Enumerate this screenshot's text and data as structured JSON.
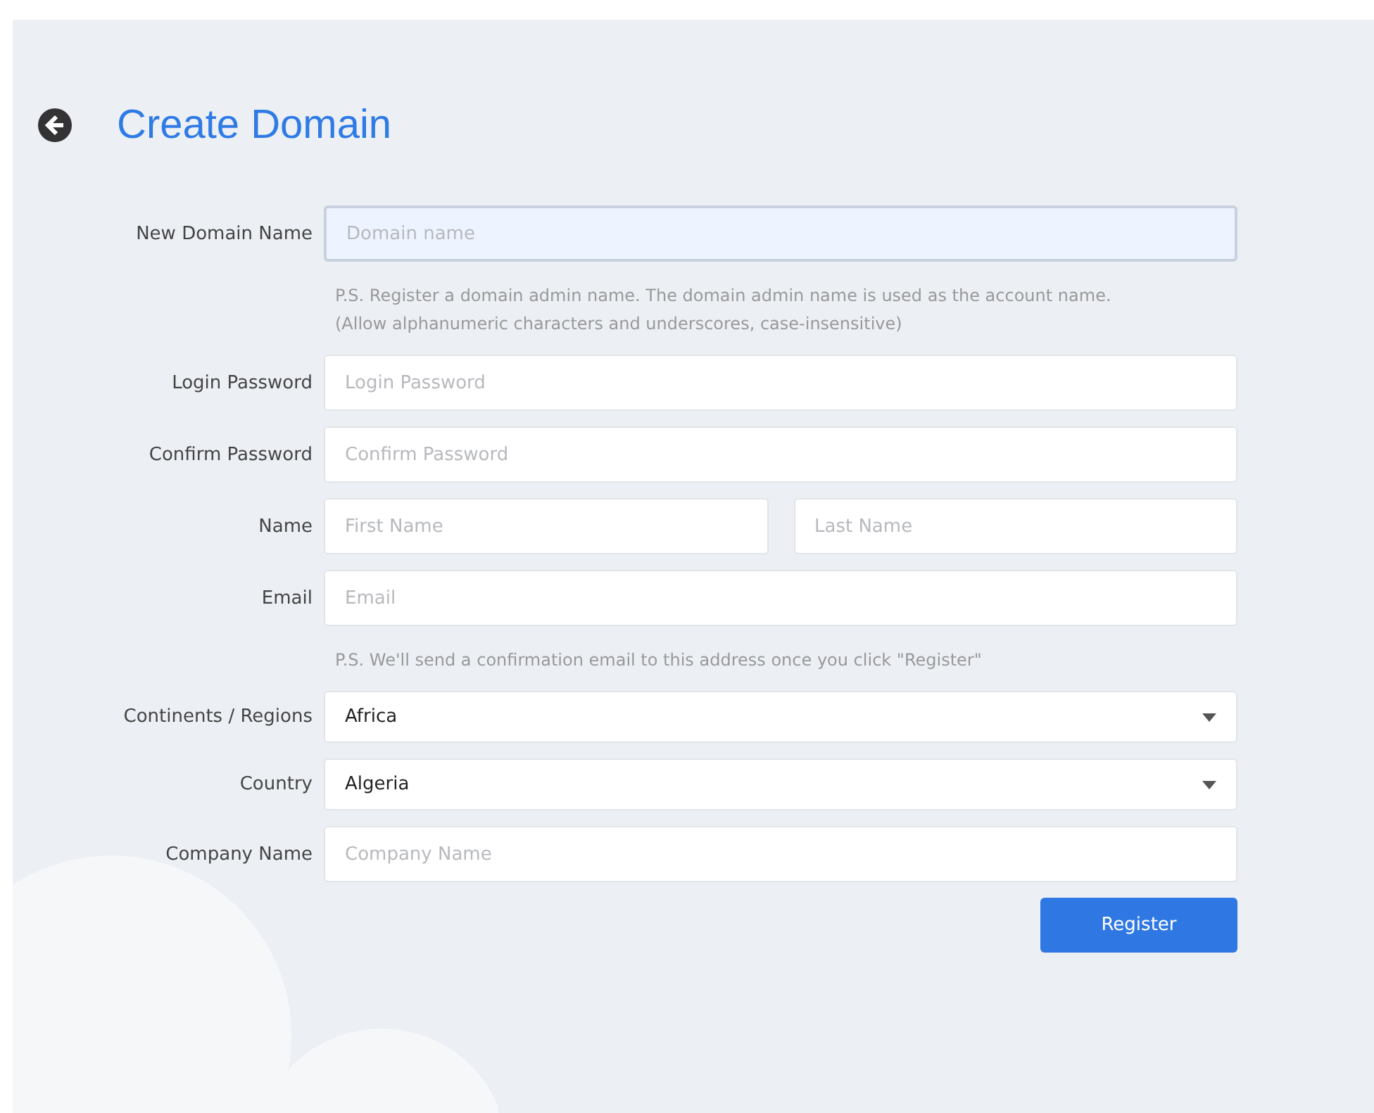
{
  "header": {
    "title": "Create Domain"
  },
  "form": {
    "rows": [
      {
        "kind": "text",
        "label": "New Domain Name",
        "placeholder": "Domain name",
        "focused": true,
        "hint": [
          "P.S. Register a domain admin name. The domain admin name is used as the account name.",
          "(Allow alphanumeric characters and underscores, case-insensitive)"
        ]
      },
      {
        "kind": "password",
        "label": "Login Password",
        "placeholder": "Login Password",
        "focused": false
      },
      {
        "kind": "password",
        "label": "Confirm Password",
        "placeholder": "Confirm Password",
        "focused": false
      },
      {
        "kind": "name",
        "label": "Name",
        "fields": [
          {
            "placeholder": "First Name",
            "focused": false
          },
          {
            "placeholder": "Last Name",
            "focused": false
          }
        ]
      },
      {
        "kind": "text",
        "label": "Email",
        "placeholder": "Email",
        "focused": false,
        "hint": [
          "P.S. We'll send a confirmation email to this address once you click \"Register\""
        ]
      },
      {
        "kind": "select",
        "label": "Continents / Regions",
        "value": "Africa"
      },
      {
        "kind": "select",
        "label": "Country",
        "value": "Algeria"
      },
      {
        "kind": "text",
        "label": "Company Name",
        "placeholder": "Company Name",
        "focused": false
      }
    ],
    "submit": "Register"
  }
}
